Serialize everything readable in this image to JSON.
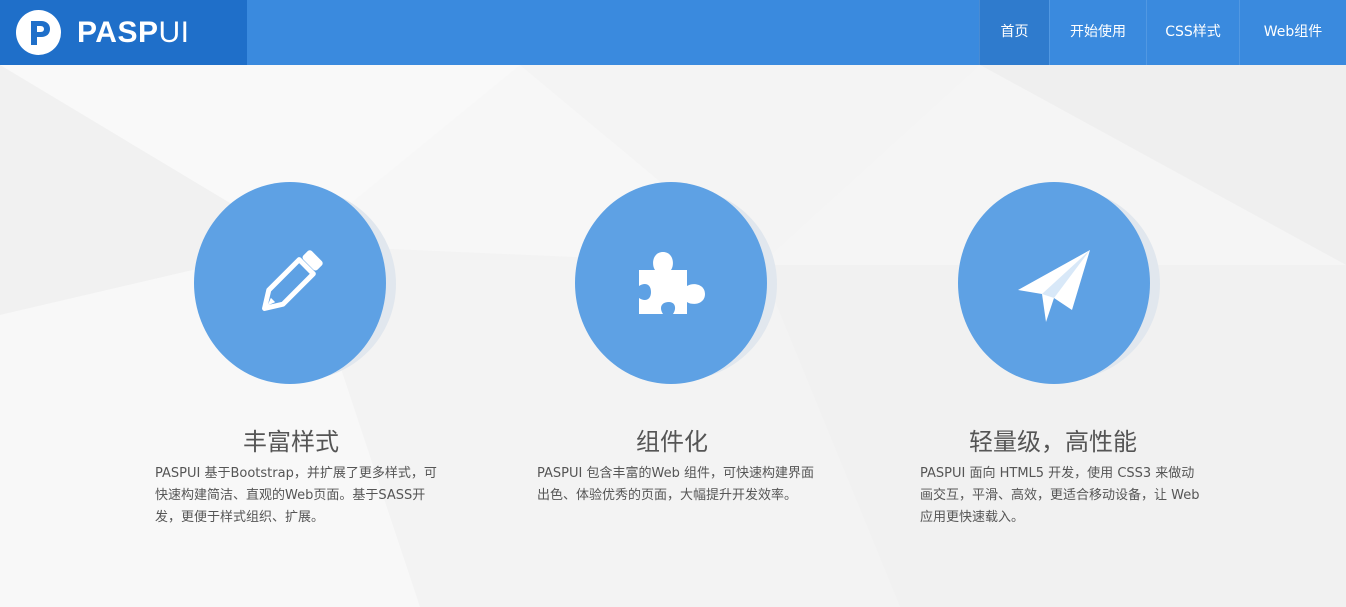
{
  "brand": {
    "name_bold": "PASP",
    "name_light": "UI",
    "logo_icon": "p-logo-icon",
    "color": "#1f6fc9"
  },
  "nav": {
    "items": [
      {
        "label": "首页",
        "active": true
      },
      {
        "label": "开始使用",
        "active": false
      },
      {
        "label": "CSS样式",
        "active": false
      },
      {
        "label": "Web组件",
        "active": false
      }
    ],
    "bar_color": "#3a8ade"
  },
  "features": [
    {
      "icon": "pencil-icon",
      "title": "丰富样式",
      "desc": "PASPUI 基于Bootstrap，并扩展了更多样式，可快速构建简洁、直观的Web页面。基于SASS开发，更便于样式组织、扩展。"
    },
    {
      "icon": "puzzle-icon",
      "title": "组件化",
      "desc": "PASPUI 包含丰富的Web 组件，可快速构建界面出色、体验优秀的页面，大幅提升开发效率。"
    },
    {
      "icon": "paper-plane-icon",
      "title": "轻量级，高性能",
      "desc": "PASPUI 面向 HTML5 开发，使用 CSS3 来做动画交互，平滑、高效，更适合移动设备，让 Web 应用更快速载入。"
    }
  ],
  "accent_color": "#5ea1e4"
}
